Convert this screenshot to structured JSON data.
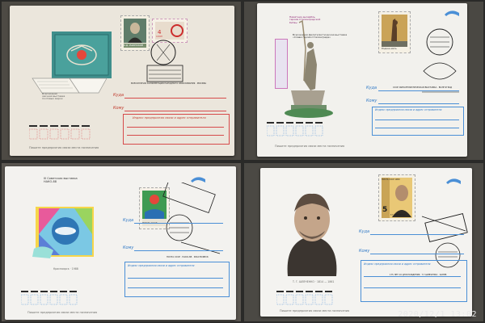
{
  "photo": {
    "timestamp": "2020/12/1 13:02"
  },
  "envelopes": [
    {
      "title_text": "Всесоюзная\nзаочная выставка\nпочтовых марок",
      "stamp_value": "4 КОП",
      "stamp_name": "К.Д. УШИНСКИЙ",
      "postmark_text": "ВСЕСОЮЗНАЯ КОНФЕРЕНЦИЯ НАРОДНОГО ОБРАЗОВАНИЯ · МОСКВА",
      "label_kuda": "Куда",
      "label_komu": "Кому",
      "bottom_caption": "Пишите предприятия связи места назначения",
      "address_caption": "Индекс предприятия связи и адрес отправителя"
    },
    {
      "title_text": "Всесоюзная филателистическая выставка\n«Слава героям Сталинграда»",
      "stamp_name": "Родина-мать",
      "postmark_text": "СССР ФИЛАТЕЛИСТИЧЕСКАЯ ВЫСТАВКА · ВОЛГОГРАД",
      "label_kuda": "Куда",
      "label_komu": "Кому",
      "bottom_caption": "Пишите предприятия связи места назначения",
      "address_caption": "Индекс предприятия связи и адрес отправителя",
      "left_text": "Памятник-ансамбль\nгероям Сталинградской\nбитвы"
    },
    {
      "title_text": "III Советская выставка\nНАКО-88",
      "stamp_name": "ПОЧТА СССР",
      "postmark_text": "ПОЧТА СССР · НАКО-88 · КРАСНОЯРСК",
      "label_kuda": "Куда",
      "label_komu": "Кому",
      "bottom_caption": "Пишите предприятия связи места назначения",
      "address_caption": "Индекс предприятия связи и адрес отправителя",
      "left_caption": "Красноярск · 1988"
    },
    {
      "portrait_caption": "Т. Г. ШЕВЧЕНКО · 1814 — 1861",
      "stamp_header": "ПОЧТА СССР 1989",
      "stamp_value": "5",
      "stamp_name": "Т.Г.ШЕВЧЕНКО",
      "postmark_text": "175 ЛЕТ СО ДНЯ РОЖДЕНИЯ · Т.Г.ШЕВЧЕНКО · КАНЕВ",
      "label_kuda": "Куда",
      "label_komu": "Кому",
      "bottom_caption": "Пишите предприятия связи места назначения",
      "address_caption": "Индекс предприятия связи и адрес отправителя"
    }
  ],
  "colors": {
    "background": "#2a2a28",
    "envelope_paper": "#ece8de",
    "envelope_blue": "#f1f1ee",
    "line_red": "#d64b4b",
    "line_blue": "#4a8fd6",
    "stamp_red": "#cc2d2d"
  }
}
